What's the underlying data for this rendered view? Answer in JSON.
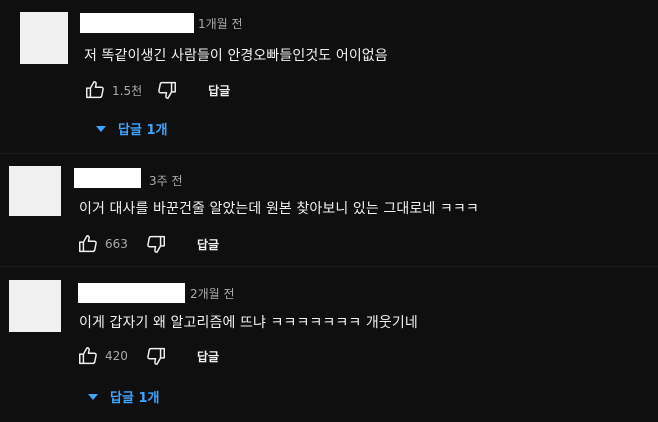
{
  "comments": [
    {
      "time": "1개월 전",
      "text": "저 똑같이생긴 사람들이 안경오빠들인것도 어이없음",
      "like_count": "1.5천",
      "reply_label": "답글",
      "replies_toggle": "답글 1개"
    },
    {
      "time": "3주 전",
      "text": "이거 대사를 바꾼건줄 알았는데 원본 찾아보니 있는 그대로네 ㅋㅋㅋ",
      "like_count": "663",
      "reply_label": "답글"
    },
    {
      "time": "2개월 전",
      "text": "이게 갑자기 왜 알고리즘에 뜨냐 ㅋㅋㅋㅋㅋㅋㅋ 개웃기네",
      "like_count": "420",
      "reply_label": "답글",
      "replies_toggle": "답글 1개"
    }
  ],
  "icons": {
    "like": "thumbs-up-icon",
    "dislike": "thumbs-down-icon",
    "expand": "caret-down-icon"
  },
  "colors": {
    "background": "#0f0f0f",
    "text": "#f1f1f1",
    "secondary_text": "#aaaaaa",
    "link": "#3ea6ff",
    "avatar_placeholder": "#f0f0f0"
  }
}
